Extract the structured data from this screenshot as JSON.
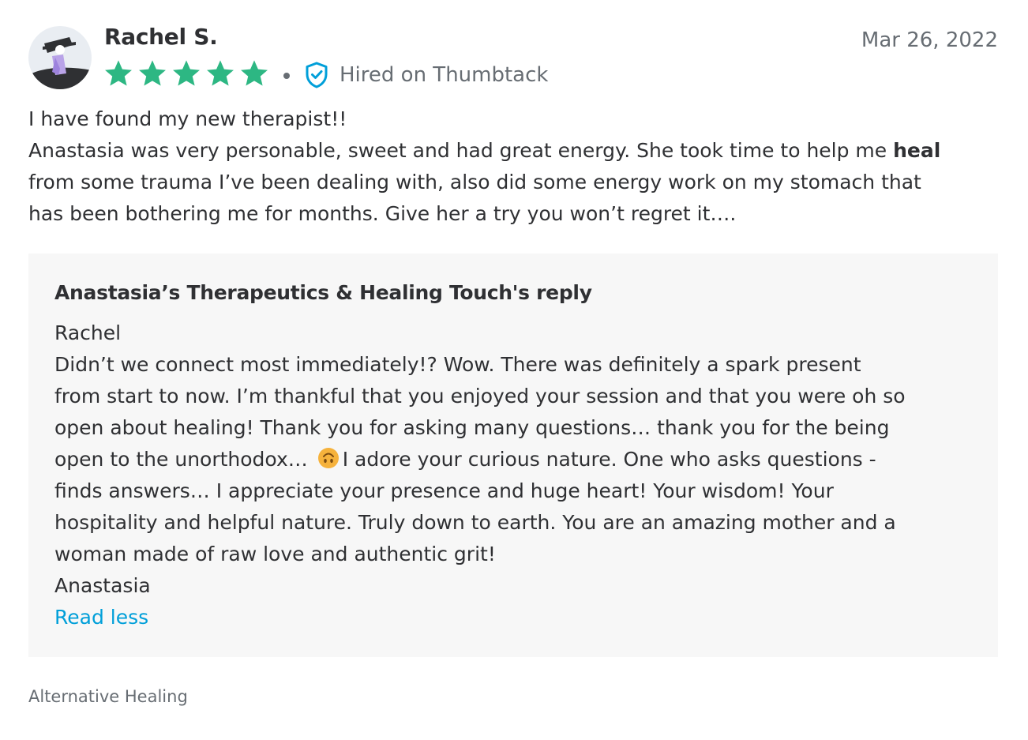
{
  "review": {
    "reviewer_name": "Rachel S.",
    "date": "Mar 26, 2022",
    "rating": 5,
    "star_color": "#2db783",
    "hired_label": "Hired on Thumbtack",
    "body": {
      "line1": "I have found my new therapist!!",
      "line2_pre": "Anastasia was very personable, sweet and had great energy. She took time to help me ",
      "line2_bold": "heal",
      "line3": "from some trauma I’ve been dealing with, also did some energy work on my stomach that",
      "line4": "has been bothering me for months. Give her a try you won’t regret it…."
    }
  },
  "reply": {
    "title": "Anastasia’s Therapeutics & Healing Touch's reply",
    "greeting": "Rachel",
    "line1": "Didn’t we connect most immediately!? Wow. There was definitely a spark present",
    "line2": "from start to now. I’m thankful that you enjoyed your session and that you were oh so",
    "line3": "open about healing! Thank you for asking many questions… thank you for the being",
    "line4_pre": "open to the unorthodox…",
    "line4_post": "I adore your curious nature. One who asks questions -",
    "line5": "finds answers… I appreciate your presence and huge heart! Your wisdom! Your",
    "line6": "hospitality and helpful nature. Truly down to earth. You are an amazing mother and a",
    "line7": "woman made of raw love and authentic grit!",
    "signature": "Anastasia",
    "read_less_label": "Read less",
    "emoji_icon": "upside-down-face-emoji-icon",
    "link_color": "#009fd9"
  },
  "category": "Alternative Healing",
  "icons": {
    "avatar": "person-avatar-icon",
    "star": "star-icon",
    "shield": "verified-shield-icon"
  }
}
